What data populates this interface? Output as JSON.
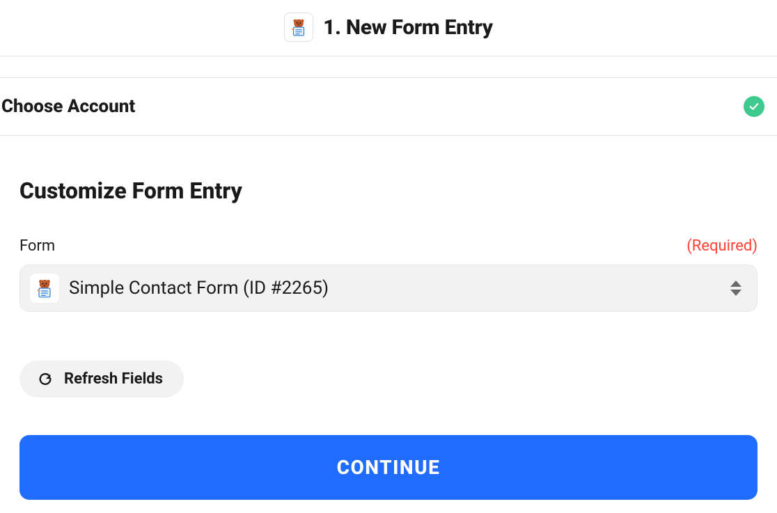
{
  "step": {
    "title": "1. New Form Entry"
  },
  "accountSection": {
    "label": "Choose Account"
  },
  "customize": {
    "title": "Customize Form Entry",
    "formLabel": "Form",
    "requiredLabel": "(Required)",
    "selectedForm": "Simple Contact Form (ID #2265)"
  },
  "actions": {
    "refreshLabel": "Refresh Fields",
    "continueLabel": "CONTINUE"
  },
  "icons": {
    "app": "wpforms-icon",
    "check": "check-icon",
    "refresh": "refresh-icon",
    "caret": "sort-caret-icon"
  }
}
